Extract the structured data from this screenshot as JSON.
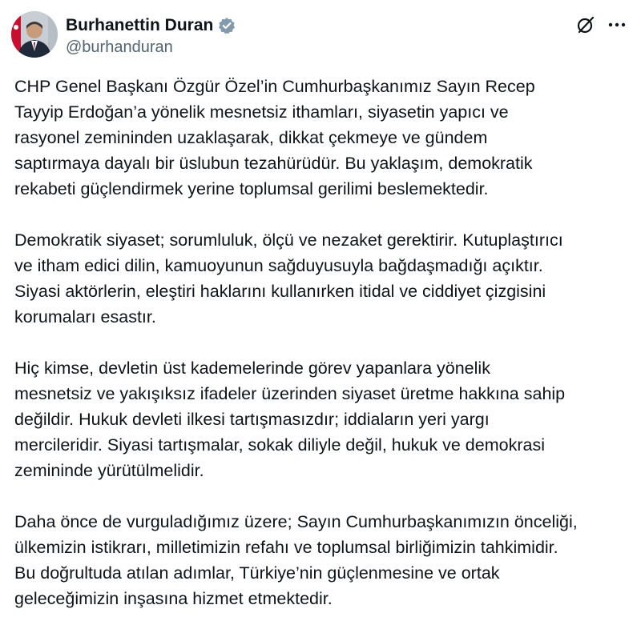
{
  "author": {
    "name": "Burhanettin Duran",
    "handle": "@burhanduran",
    "verified": true,
    "verified_color": "#829aab"
  },
  "icons": {
    "avatar": "profile-photo",
    "verified": "verified-badge-icon",
    "grok": "grok-slash-icon",
    "more": "more-horizontal-icon"
  },
  "paragraphs": [
    {
      "lines": [
        "CHP Genel Başkanı Özgür Özel’in Cumhurbaşkanımız Sayın Recep",
        "Tayyip Erdoğan’a yönelik mesnetsiz ithamları, siyasetin yapıcı ve",
        "rasyonel zemininden uzaklaşarak, dikkat çekmeye ve gündem",
        "saptırmaya dayalı bir üslubun tezahürüdür. Bu yaklaşım, demokratik",
        "rekabeti güçlendirmek yerine toplumsal gerilimi beslemektedir."
      ]
    },
    {
      "lines": [
        "Demokratik siyaset; sorumluluk, ölçü ve nezaket gerektirir. Kutuplaştırıcı",
        "ve itham edici dilin, kamuoyunun sağduyusuyla bağdaşmadığı açıktır.",
        "Siyasi aktörlerin, eleştiri haklarını kullanırken itidal ve ciddiyet çizgisini",
        "korumaları esastır."
      ]
    },
    {
      "lines": [
        "Hiç kimse, devletin üst kademelerinde görev yapanlara yönelik",
        "mesnetsiz ve yakışıksız ifadeler üzerinden siyaset üretme hakkına sahip",
        "değildir. Hukuk devleti ilkesi tartışmasızdır; iddiaların yeri yargı",
        "mercileridir. Siyasi tartışmalar, sokak diliyle değil, hukuk ve demokrasi",
        "zemininde yürütülmelidir."
      ]
    },
    {
      "lines": [
        "Daha önce de vurguladığımız üzere; Sayın Cumhurbaşkanımızın önceliği,",
        "ülkemizin istikrarı, milletimizin refahı ve toplumsal birliğimizin tahkimidir.",
        "Bu doğrultuda atılan adımlar, Türkiye’nin güçlenmesine ve ortak",
        "geleceğimizin inşasına hizmet etmektedir."
      ]
    }
  ]
}
